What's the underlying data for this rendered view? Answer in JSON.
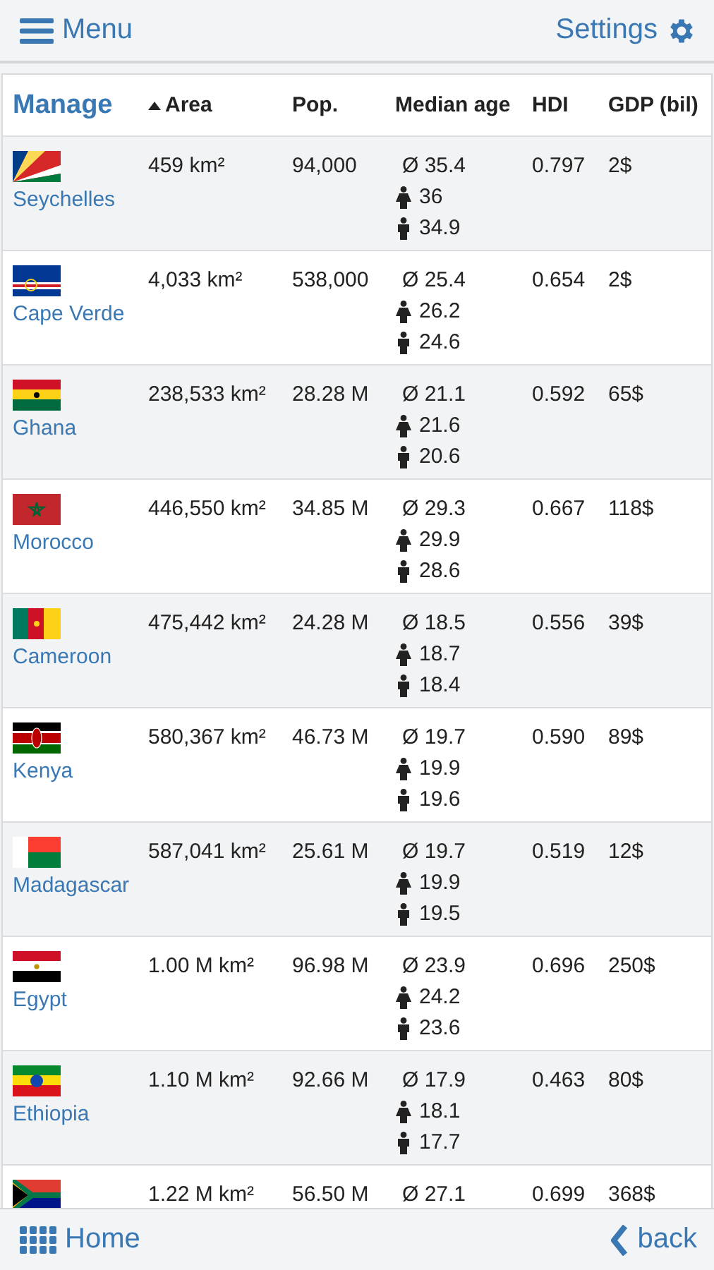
{
  "header": {
    "menu": "Menu",
    "settings": "Settings"
  },
  "table": {
    "title": "Manage",
    "columns": [
      {
        "label": "Area",
        "sorted": true
      },
      {
        "label": "Pop.",
        "sorted": false
      },
      {
        "label": "Median age",
        "sorted": false
      },
      {
        "label": "HDI",
        "sorted": false
      },
      {
        "label": "GDP (bil)",
        "sorted": false
      }
    ],
    "rows": [
      {
        "name": "Seychelles",
        "area": "459 km²",
        "population": "94,000",
        "median": {
          "average": "Ø 35.4",
          "female": "36",
          "male": "34.9"
        },
        "hdi": "0.797",
        "gdp": "2$"
      },
      {
        "name": "Cape Verde",
        "area": "4,033 km²",
        "population": "538,000",
        "median": {
          "average": "Ø 25.4",
          "female": "26.2",
          "male": "24.6"
        },
        "hdi": "0.654",
        "gdp": "2$"
      },
      {
        "name": "Ghana",
        "area": "238,533 km²",
        "population": "28.28 M",
        "median": {
          "average": "Ø 21.1",
          "female": "21.6",
          "male": "20.6"
        },
        "hdi": "0.592",
        "gdp": "65$"
      },
      {
        "name": "Morocco",
        "area": "446,550 km²",
        "population": "34.85 M",
        "median": {
          "average": "Ø 29.3",
          "female": "29.9",
          "male": "28.6"
        },
        "hdi": "0.667",
        "gdp": "118$"
      },
      {
        "name": "Cameroon",
        "area": "475,442 km²",
        "population": "24.28 M",
        "median": {
          "average": "Ø 18.5",
          "female": "18.7",
          "male": "18.4"
        },
        "hdi": "0.556",
        "gdp": "39$"
      },
      {
        "name": "Kenya",
        "area": "580,367 km²",
        "population": "46.73 M",
        "median": {
          "average": "Ø 19.7",
          "female": "19.9",
          "male": "19.6"
        },
        "hdi": "0.590",
        "gdp": "89$"
      },
      {
        "name": "Madagascar",
        "area": "587,041 km²",
        "population": "25.61 M",
        "median": {
          "average": "Ø 19.7",
          "female": "19.9",
          "male": "19.5"
        },
        "hdi": "0.519",
        "gdp": "12$"
      },
      {
        "name": "Egypt",
        "area": "1.00 M km²",
        "population": "96.98 M",
        "median": {
          "average": "Ø 23.9",
          "female": "24.2",
          "male": "23.6"
        },
        "hdi": "0.696",
        "gdp": "250$"
      },
      {
        "name": "Ethiopia",
        "area": "1.10 M km²",
        "population": "92.66 M",
        "median": {
          "average": "Ø 17.9",
          "female": "18.1",
          "male": "17.7"
        },
        "hdi": "0.463",
        "gdp": "80$"
      },
      {
        "area": "1.22 M km²",
        "population": "56.50 M",
        "median": {
          "average": "Ø 27.1"
        },
        "hdi": "0.699",
        "gdp": "368$"
      }
    ]
  },
  "footer": {
    "home": "Home",
    "back": "back"
  }
}
